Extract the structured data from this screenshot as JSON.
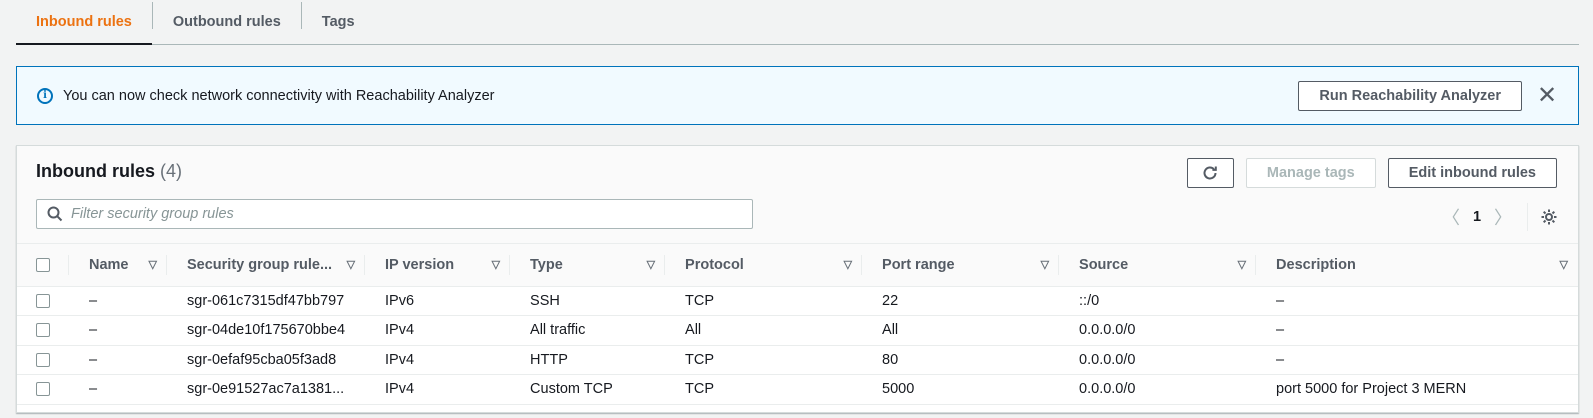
{
  "tabs": [
    {
      "label": "Inbound rules",
      "active": true
    },
    {
      "label": "Outbound rules",
      "active": false
    },
    {
      "label": "Tags",
      "active": false
    }
  ],
  "flash": {
    "message": "You can now check network connectivity with Reachability Analyzer",
    "action_label": "Run Reachability Analyzer",
    "info_icon": "info-icon",
    "close_icon": "close-icon",
    "border_color": "#0073bb",
    "background": "#f1faff"
  },
  "panel": {
    "title": "Inbound rules",
    "count": "(4)",
    "refresh_icon": "refresh-icon",
    "manage_tags_label": "Manage tags",
    "edit_label": "Edit inbound rules",
    "filter_placeholder": "Filter security group rules",
    "page": "1"
  },
  "table": {
    "columns": [
      "Name",
      "Security group rule...",
      "IP version",
      "Type",
      "Protocol",
      "Port range",
      "Source",
      "Description"
    ],
    "rows": [
      [
        "–",
        "sgr-061c7315df47bb797",
        "IPv6",
        "SSH",
        "TCP",
        "22",
        "::/0",
        "–"
      ],
      [
        "–",
        "sgr-04de10f175670bbe4",
        "IPv4",
        "All traffic",
        "All",
        "All",
        "0.0.0.0/0",
        "–"
      ],
      [
        "–",
        "sgr-0efaf95cba05f3ad8",
        "IPv4",
        "HTTP",
        "TCP",
        "80",
        "0.0.0.0/0",
        "–"
      ],
      [
        "–",
        "sgr-0e91527ac7a1381...",
        "IPv4",
        "Custom TCP",
        "TCP",
        "5000",
        "0.0.0.0/0",
        "port 5000 for Project 3 MERN"
      ]
    ]
  },
  "colors": {
    "active_tab": "#ec7211",
    "text": "#16191f",
    "secondary_text": "#545b64"
  }
}
